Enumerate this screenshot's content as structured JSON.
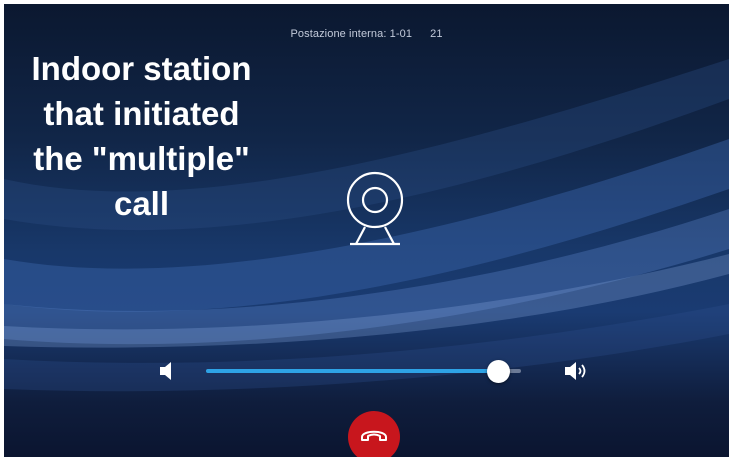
{
  "header": {
    "station_label": "Postazione interna: 1-01",
    "count": "21"
  },
  "overlay_caption": {
    "lines": [
      "Indoor station",
      "that initiated",
      "the \"multiple\"",
      "call"
    ]
  },
  "main": {
    "camera_icon": "webcam-icon"
  },
  "volume": {
    "level": 0.93,
    "low_icon": "speaker-low-icon",
    "high_icon": "speaker-high-icon",
    "accent_color": "#2ea3e6"
  },
  "call_controls": {
    "hangup_icon": "phone-hangup-icon",
    "hangup_color": "#c8161d"
  }
}
